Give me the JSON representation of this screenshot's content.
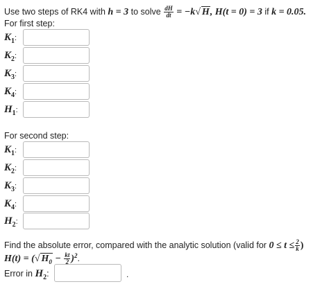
{
  "question": {
    "prefix": "Use two steps of RK4 with",
    "h_expr": "h = 3",
    "to_solve": "to solve",
    "deriv_num": "dH",
    "deriv_den": "dt",
    "eq_rhs_1": " = −k",
    "eq_sqrt": "H",
    "eq_rhs_2": ", H(t = 0) = 3",
    "if_text": "if",
    "k_expr": "k = 0.05."
  },
  "step1": {
    "title": "For first step:",
    "labels": [
      {
        "var": "K",
        "sub": "1"
      },
      {
        "var": "K",
        "sub": "2"
      },
      {
        "var": "K",
        "sub": "3"
      },
      {
        "var": "K",
        "sub": "4"
      },
      {
        "var": "H",
        "sub": "1"
      }
    ]
  },
  "step2": {
    "title": "For second step:",
    "labels": [
      {
        "var": "K",
        "sub": "1"
      },
      {
        "var": "K",
        "sub": "2"
      },
      {
        "var": "K",
        "sub": "3"
      },
      {
        "var": "K",
        "sub": "4"
      },
      {
        "var": "H",
        "sub": "2"
      }
    ]
  },
  "analytic": {
    "text": "Find the absolute error, compared with the analytic solution (valid for",
    "range_start": "0 ≤ t ≤",
    "range_num": "2",
    "range_den": "k",
    "close_paren": ")",
    "sol_lhs": "H(t) = (",
    "sol_sqrt": "H",
    "sol_sqrt_sub": "0",
    "sol_minus": " − ",
    "sol_frac_num": "kt",
    "sol_frac_den": "2",
    "sol_end": ")",
    "sol_power": "2",
    "sol_period": "."
  },
  "error": {
    "label": "Error in",
    "var": "H",
    "sub": "2",
    "trailing": "."
  },
  "colon": ":"
}
